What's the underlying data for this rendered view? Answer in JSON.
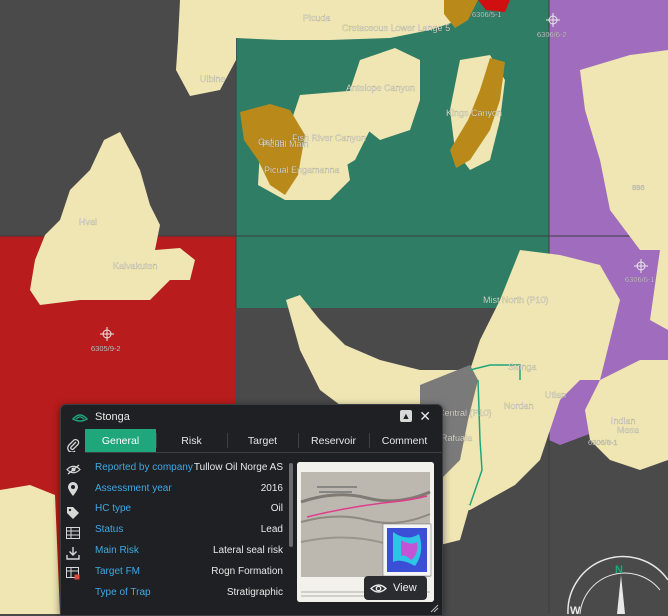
{
  "map": {
    "area_labels": {
      "picuda": "Picuda",
      "cretaceous": "Cretaceous Lower Lange 5",
      "ulbine": "Ulbine",
      "antelope": "Antelope Canyon",
      "kings": "Kings Canyon",
      "gefion": "Gefion",
      "fish_river": "Fish River Canyon",
      "picual_main": "Picual Main",
      "picual_eng": "Picual Engamanna",
      "hval": "Hval",
      "kalvakuten": "Kalvakuten",
      "mist_north": "Mist North (P10)",
      "stonga": "Stonga",
      "utlan": "Utlan",
      "nordan": "Nordan",
      "central": "Central (P10)",
      "rafuala": "Rafuala",
      "indian": "Indian",
      "mesa": "Mesa"
    },
    "well_labels": {
      "w1": "6306/5-1",
      "w2": "6306/6-2",
      "w3": "6306/6-1",
      "w4": "6305/9-2",
      "w5": "886",
      "w6": "6306/8-1"
    },
    "compass": {
      "north": "N",
      "west": "W"
    },
    "colors": {
      "background": "#4a4a4a",
      "prospect": "#efe6b3",
      "green_block": "#2f7d64",
      "red_block": "#b81c1c",
      "purple_block": "#a06cbe",
      "lead": "#b98a1a",
      "accent": "#1fa67a"
    }
  },
  "popup": {
    "title": "Stonga",
    "tabs": [
      "General",
      "Risk",
      "Target",
      "Reservoir",
      "Comment"
    ],
    "active_tab": "General",
    "properties": [
      {
        "key": "Reported by company",
        "value": "Tullow Oil Norge AS"
      },
      {
        "key": "Assessment year",
        "value": "2016"
      },
      {
        "key": "HC type",
        "value": "Oil"
      },
      {
        "key": "Status",
        "value": "Lead"
      },
      {
        "key": "Main Risk",
        "value": "Lateral seal risk"
      },
      {
        "key": "Target FM",
        "value": "Rogn Formation"
      },
      {
        "key": "Type of Trap",
        "value": "Stratigraphic"
      }
    ],
    "view_label": "View",
    "icons": [
      "attachment-icon",
      "hide-icon",
      "location-pin-icon",
      "tag-icon",
      "table-icon",
      "download-icon",
      "table-export-icon"
    ]
  }
}
